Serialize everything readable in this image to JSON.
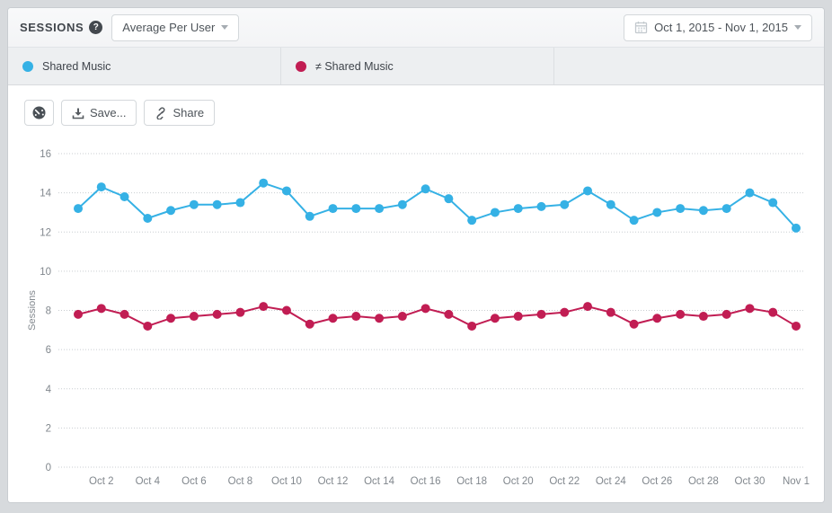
{
  "header": {
    "title": "SESSIONS",
    "help_icon": "?",
    "metric_selector": {
      "value": "Average Per User"
    },
    "date_picker": {
      "value": "Oct 1, 2015 - Nov 1, 2015"
    }
  },
  "legend": {
    "tabs": [
      {
        "label": "Shared Music",
        "color": "#35b1e5"
      },
      {
        "label": "≠ Shared Music",
        "color": "#c11d53"
      }
    ]
  },
  "toolbar": {
    "gauge_icon": "dashboard-gauge",
    "save_label": "Save...",
    "share_label": "Share"
  },
  "colors": {
    "blue_series": "#35b1e5",
    "red_series": "#c11d53",
    "grid": "#c9cdd1",
    "axis_text": "#81878d",
    "page_background": "#d7dadd"
  },
  "chart_data": {
    "type": "line",
    "title": "",
    "xlabel": "",
    "ylabel": "Sessions",
    "ylim": [
      0,
      16
    ],
    "yticks": [
      0,
      2,
      4,
      6,
      8,
      10,
      12,
      14,
      16
    ],
    "grid": "horizontal-dotted",
    "legend_position": "top-tabs",
    "x": [
      "Oct 1",
      "Oct 2",
      "Oct 3",
      "Oct 4",
      "Oct 5",
      "Oct 6",
      "Oct 7",
      "Oct 8",
      "Oct 9",
      "Oct 10",
      "Oct 11",
      "Oct 12",
      "Oct 13",
      "Oct 14",
      "Oct 15",
      "Oct 16",
      "Oct 17",
      "Oct 18",
      "Oct 19",
      "Oct 20",
      "Oct 21",
      "Oct 22",
      "Oct 23",
      "Oct 24",
      "Oct 25",
      "Oct 26",
      "Oct 27",
      "Oct 28",
      "Oct 29",
      "Oct 30",
      "Oct 31",
      "Nov 1"
    ],
    "x_tick_labels": [
      "Oct 2",
      "Oct 4",
      "Oct 6",
      "Oct 8",
      "Oct 10",
      "Oct 12",
      "Oct 14",
      "Oct 16",
      "Oct 18",
      "Oct 20",
      "Oct 22",
      "Oct 24",
      "Oct 26",
      "Oct 28",
      "Oct 30",
      "Nov 1"
    ],
    "series": [
      {
        "name": "Shared Music",
        "color": "#35b1e5",
        "values": [
          13.2,
          14.3,
          13.8,
          12.7,
          13.1,
          13.4,
          13.4,
          13.5,
          14.5,
          14.1,
          12.8,
          13.2,
          13.2,
          13.2,
          13.4,
          14.2,
          13.7,
          12.6,
          13.0,
          13.2,
          13.3,
          13.4,
          14.1,
          13.4,
          12.6,
          13.0,
          13.2,
          13.1,
          13.2,
          14.0,
          13.5,
          12.2
        ]
      },
      {
        "name": "≠ Shared Music",
        "color": "#c11d53",
        "values": [
          7.8,
          8.1,
          7.8,
          7.2,
          7.6,
          7.7,
          7.8,
          7.9,
          8.2,
          8.0,
          7.3,
          7.6,
          7.7,
          7.6,
          7.7,
          8.1,
          7.8,
          7.2,
          7.6,
          7.7,
          7.8,
          7.9,
          8.2,
          7.9,
          7.3,
          7.6,
          7.8,
          7.7,
          7.8,
          8.1,
          7.9,
          7.2
        ]
      }
    ]
  }
}
